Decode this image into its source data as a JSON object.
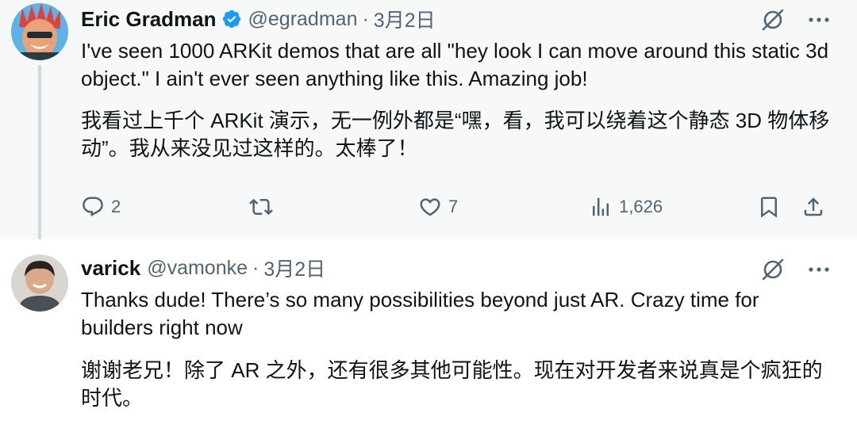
{
  "tweets": [
    {
      "author_name": "Eric Gradman",
      "verified": true,
      "handle": "@egradman",
      "separator": "·",
      "time": "3月2日",
      "text_en": "I've seen 1000 ARKit demos that are all \"hey look I can move around this static 3d object.\"  I ain't ever seen anything like this.  Amazing job!",
      "text_zh": "我看过上千个 ARKit 演示，无一例外都是“嘿，看，我可以绕着这个静态 3D 物体移动”。我从来没见过这样的。太棒了！",
      "actions": {
        "reply_count": "2",
        "retweet_count": "",
        "like_count": "7",
        "views_count": "1,626"
      }
    },
    {
      "author_name": "varick",
      "verified": false,
      "handle": "@vamonke",
      "separator": "·",
      "time": "3月2日",
      "text_en": "Thanks dude! There’s so many possibilities beyond just AR. Crazy time for builders right now",
      "text_zh": "谢谢老兄！除了 AR 之外，还有很多其他可能性。现在对开发者来说真是个疯狂的时代。"
    }
  ],
  "colors": {
    "text_primary": "#0f1419",
    "text_secondary": "#536471",
    "verified_blue": "#1d9bf0",
    "thread_line": "#cfd9de",
    "focused_bg": "#f7f9f9"
  },
  "icons": [
    "verified-badge-icon",
    "grok-icon",
    "more-icon",
    "reply-icon",
    "retweet-icon",
    "like-icon",
    "views-icon",
    "bookmark-icon",
    "share-icon"
  ]
}
